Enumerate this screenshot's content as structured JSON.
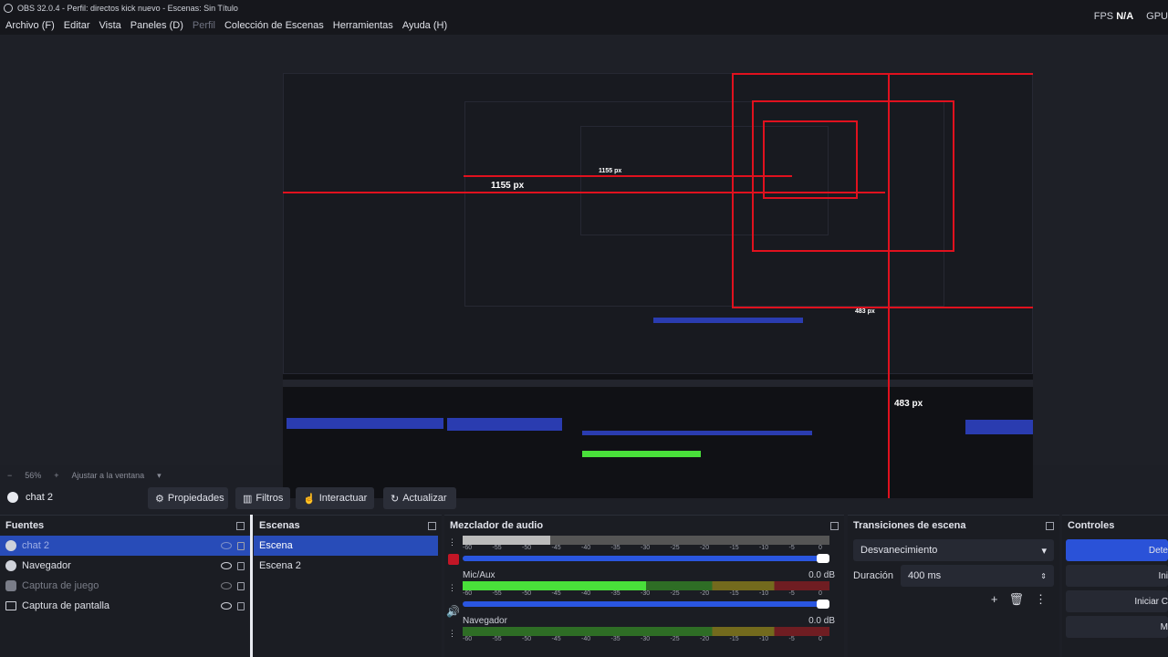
{
  "window": {
    "title": "OBS 32.0.4 - Perfil: directos kick nuevo - Escenas: Sin Título"
  },
  "menu": {
    "items": [
      "Archivo (F)",
      "Editar",
      "Vista",
      "Paneles (D)",
      "Perfil",
      "Colección de Escenas",
      "Herramientas",
      "Ayuda (H)"
    ]
  },
  "stats": {
    "fps_label": "FPS",
    "fps_value": "N/A",
    "gpu_label": "GPU"
  },
  "preview": {
    "labels": {
      "a": "1155 px",
      "b": "1155 px",
      "c": "483 px",
      "d": "483 px"
    }
  },
  "zoom": {
    "value": "56%",
    "fit": "Ajustar a la ventana"
  },
  "scene_toolbar": {
    "current": "chat 2",
    "properties": "Propiedades",
    "filters": "Filtros",
    "interact": "Interactuar",
    "refresh": "Actualizar"
  },
  "sources": {
    "title": "Fuentes",
    "items": [
      {
        "label": "chat 2",
        "selected": true,
        "dim": true
      },
      {
        "label": "Navegador",
        "selected": false,
        "dim": false
      },
      {
        "label": "Captura de juego",
        "selected": false,
        "dim": true
      },
      {
        "label": "Captura de pantalla",
        "selected": false,
        "dim": false
      }
    ]
  },
  "scenes": {
    "title": "Escenas",
    "items": [
      {
        "label": "Escena",
        "selected": true
      },
      {
        "label": "Escena 2",
        "selected": false
      }
    ]
  },
  "mixer": {
    "title": "Mezclador de audio",
    "ticks": [
      "-60",
      "-55",
      "-50",
      "-45",
      "-40",
      "-35",
      "-30",
      "-25",
      "-20",
      "-15",
      "-10",
      "-5",
      "0"
    ],
    "channels": [
      {
        "name": "",
        "db": "",
        "level": 0.24,
        "muted": true
      },
      {
        "name": "Mic/Aux",
        "db": "0.0 dB",
        "level": 0.5,
        "muted": false
      },
      {
        "name": "Navegador",
        "db": "0.0 dB",
        "level": 0.0,
        "muted": false
      }
    ]
  },
  "transitions": {
    "title": "Transiciones de escena",
    "type": "Desvanecimiento",
    "duration_label": "Duración",
    "duration_value": "400 ms"
  },
  "controls": {
    "title": "Controles",
    "buttons": [
      "Dete",
      "Ini",
      "Iniciar C",
      "M"
    ]
  },
  "colors": {
    "accent": "#284cb8",
    "red_guide": "#e0111e"
  }
}
